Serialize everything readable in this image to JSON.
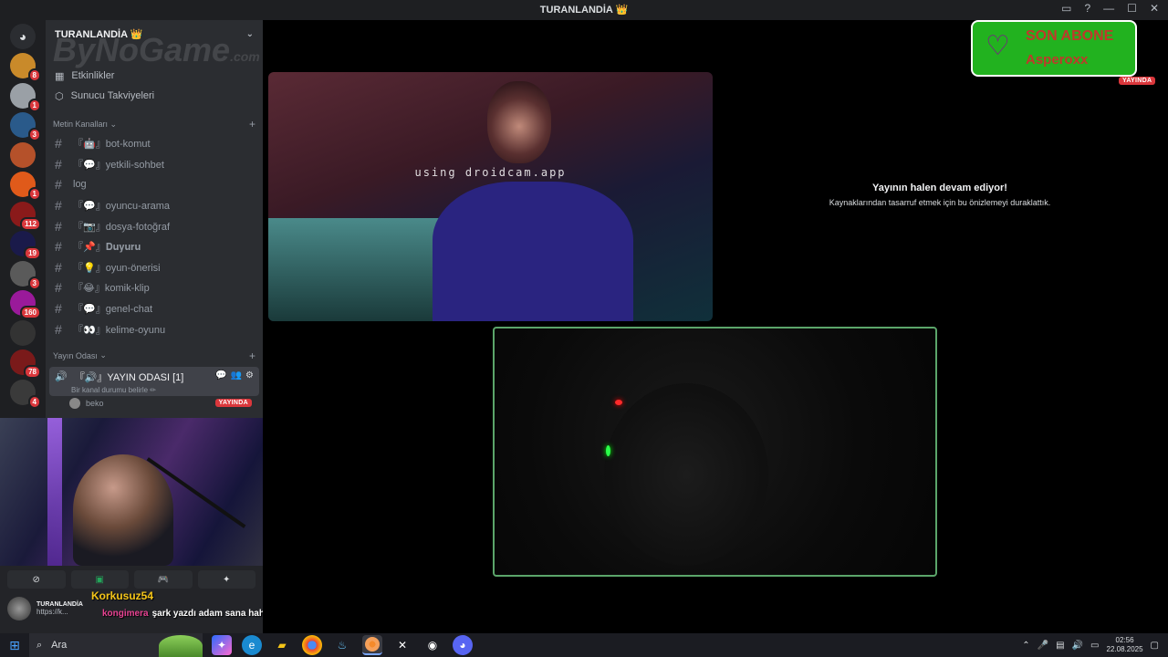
{
  "window": {
    "title": "TURANLANDİA 👑"
  },
  "server": {
    "name": "TURANLANDİA 👑",
    "watermark": "ByNoGame",
    "watermark_suffix": ".com",
    "nav": [
      {
        "label": "Etkinlikler",
        "icon": "calendar-icon"
      },
      {
        "label": "Sunucu Takviyeleri",
        "icon": "boost-icon"
      }
    ],
    "text_category": "Metin Kanalları",
    "text_channels": [
      "『🤖』bot-komut",
      "『💬』yetkili-sohbet",
      "log",
      "『💬』oyuncu-arama",
      "『📷』dosya-fotoğraf",
      "『📌』𝐃𝐮𝐲𝐮𝐫𝐮",
      "『💡』oyun-önerisi",
      "『😂』komik-klip",
      "『💬』genel-chat",
      "『👀』kelime-oyunu"
    ],
    "voice_category": "Yayın Odası",
    "voice_channel": {
      "name": "『🔊』YAYIN ODASI [1]",
      "status": "Bir kanal durumu belirle ✏",
      "user": "beko",
      "live_label": "YAYINDA"
    }
  },
  "sidebar_servers": [
    {
      "badge": "8",
      "color": "#c98a2a"
    },
    {
      "badge": "1",
      "color": "#9aa0a6"
    },
    {
      "badge": "3",
      "color": "#2a5a8a"
    },
    {
      "badge": "",
      "color": "#b5512a"
    },
    {
      "badge": "1",
      "color": "#e05a1a"
    },
    {
      "badge": "112",
      "color": "#8a1a1a"
    },
    {
      "badge": "19",
      "color": "#1a1a4a"
    },
    {
      "badge": "3",
      "color": "#5a5a5a"
    },
    {
      "badge": "160",
      "color": "#9a1a9a"
    },
    {
      "badge": "",
      "color": "#333333"
    },
    {
      "badge": "78",
      "color": "#7a1a1a"
    },
    {
      "badge": "4",
      "color": "#3a3a3a"
    }
  ],
  "user_panel": {
    "name": "TURANLANDİA",
    "status": "https://k..."
  },
  "overlay": {
    "chat_user": "Korkusuz54",
    "chat_author": "kongimera",
    "chat_message": "şark yazdı adam sana hahahhahaha",
    "sub_title": "SON ABONE",
    "sub_name": "Asperoxx",
    "live_label": "YAYINDA"
  },
  "stream": {
    "cam_watermark": "using droidcam.app",
    "paused_title": "Yayının halen devam ediyor!",
    "paused_sub": "Kaynaklarından tasarruf etmek için bu önizlemeyi duraklattık."
  },
  "taskbar": {
    "search_placeholder": "Ara",
    "time": "02:56",
    "date": "22.08.2025"
  },
  "colors": {
    "live": "#da373c",
    "sub_box": "#22b21f",
    "stream_border": "#5ba56a"
  }
}
